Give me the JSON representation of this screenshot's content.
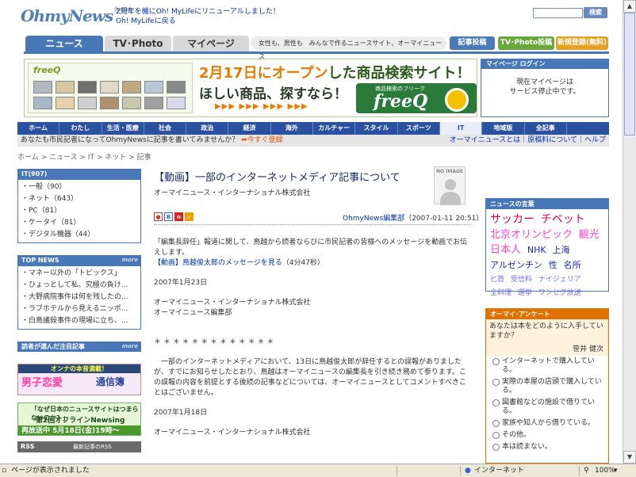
{
  "header": {
    "logo": "OhmyNews",
    "logo_small": "βversion",
    "announcement_1": "2周年を機にOh! MyLifeにリニューアルしました！",
    "announcement_2": "Oh! MyLifeに戻る",
    "search_placeholder": "",
    "search_label": "検索"
  },
  "main_tabs": [
    {
      "label": "ニュース"
    },
    {
      "label": "TV･Photo"
    },
    {
      "label": "マイページ"
    }
  ],
  "catchphrase_1": "女性も、男性も",
  "catchphrase_2": "みんなで作るニュースサイト、オーマイニュース",
  "header_buttons": {
    "post": "記事投稿",
    "tv_post": "TV･Photo投稿",
    "register": "新規登録(無料)"
  },
  "banner": {
    "small_logo": "freeQ",
    "headline_em": "2月17日にオープン",
    "headline_rest": "した商品検索サイト！",
    "subline": "ほしい商品、探すなら！",
    "arrows": "▶▶▶ ▶▶▶ ▶▶▶ ▶▶▶",
    "freeq_caption": "商品検索のフリーク",
    "freeq_logo": "freeQ"
  },
  "mypage_login": {
    "heading": "マイページ ログイン",
    "line1": "現在マイページは",
    "line2": "サービス停止中です。"
  },
  "categories": [
    {
      "label": "ホーム"
    },
    {
      "label": "わたし"
    },
    {
      "label": "生活・医療"
    },
    {
      "label": "社会"
    },
    {
      "label": "政治"
    },
    {
      "label": "経済"
    },
    {
      "label": "海外"
    },
    {
      "label": "カルチャー"
    },
    {
      "label": "スタイル"
    },
    {
      "label": "スポーツ"
    },
    {
      "label": "IT"
    },
    {
      "label": "地域版"
    },
    {
      "label": "全記事"
    }
  ],
  "subbar": {
    "prompt": "あなたも市民記者になってOhmyNewsに記事を書いてみませんか？",
    "cta": "今すぐ登録",
    "right": "オーマイニュースとは｜原稿料について｜ヘルプ"
  },
  "breadcrumb": "ホーム > ニュース > IT > ネット > 記事",
  "left": {
    "it_heading": "IT(907)",
    "it_items": [
      "・一般（90）",
      "・ネット（643）",
      "・PC（81）",
      "・ケータイ（81）",
      "・デジタル機器（44）"
    ],
    "topnews_heading": "TOP NEWS",
    "more": "more",
    "topnews_items": [
      "・マネー以外の「トピックス」",
      "・ひょっとして私、究極の負け...",
      "・大野病院事件は何を残したの...",
      "・ラブホテルから見えるニッポ...",
      "・白島議殺事件の現場に立ち、..."
    ],
    "reader_heading": "読者が選んだ注目記事",
    "ad1_top": "オンナの本音満載！",
    "ad1_left": "男子恋愛",
    "ad1_right": "通信簿",
    "ad2_line1": "「なぜ日本のニュースサイトはつまらないのか？」",
    "ad2_line2": "第2回オフラインNewsing",
    "ad2_bar": "再放送中 5月18日(金)19時〜",
    "rss_label": "RSS",
    "rss_text": "最新記事のRSS"
  },
  "article": {
    "title": "【動画】一部のインターネットメディア記事について",
    "byline": "オーマイニュース・インターナショナル株式会社",
    "noimage": "NO IMAGE",
    "author": "OhmyNews編集部",
    "date": "（2007-01-11 20:51）",
    "body_1": "「編集長辞任」報道に関して、鳥越から読者ならびに市民記者の皆様へのメッセージを動画でお伝えします。",
    "body_link": "【動画】鳥越俊太郎のメッセージを見る",
    "body_link_tail": "（4分47秒）",
    "date_1": "2007年1月23日",
    "org_1": "オーマイニュース・インターナショナル株式会社",
    "dept_1": "オーマイニュース編集部",
    "stars": "＊ ＊ ＊ ＊ ＊ ＊ ＊ ＊ ＊ ＊ ＊ ＊ ＊",
    "body_2": "　一部のインターネットメディアにおいて、13日に鳥越俊太郎が辞任するとの誤報がありましたが、すでにお知らせしたとおり、鳥越はオーマイニュースの編集長を引き続き務めて参ります。この誤報の内容を前提とする後続の記事などについては、オーマイニュースとしてコメントすべきことはございません。",
    "date_2": "2007年1月18日",
    "org_2": "オーマイニュース・インターナショナル株式会社"
  },
  "keywords": {
    "heading": "ニュースの言葉",
    "items": [
      {
        "text": "サッカー",
        "color": "#e0004a",
        "size": 14
      },
      {
        "text": "チベット",
        "color": "#e0004a",
        "size": 14
      },
      {
        "text": "北京オリンピック",
        "color": "#ff44cc",
        "size": 13
      },
      {
        "text": "観光",
        "color": "#ff44cc",
        "size": 13
      },
      {
        "text": "日本人",
        "color": "#ff44cc",
        "size": 13
      },
      {
        "text": "NHK",
        "color": "#1a2ab0",
        "size": 11
      },
      {
        "text": "上海",
        "color": "#1a2ab0",
        "size": 11
      },
      {
        "text": "アルゼンチン",
        "color": "#1a2ab0",
        "size": 11
      },
      {
        "text": "性",
        "color": "#1a2ab0",
        "size": 11
      },
      {
        "text": "名所",
        "color": "#1a2ab0",
        "size": 11
      },
      {
        "text": "匕首",
        "color": "#7070ff",
        "size": 9
      },
      {
        "text": "受信料",
        "color": "#7070ff",
        "size": 9
      },
      {
        "text": "ナイジェリア",
        "color": "#7070ff",
        "size": 9
      },
      {
        "text": "全料理",
        "color": "#7070ff",
        "size": 9
      },
      {
        "text": "選挙",
        "color": "#7070ff",
        "size": 9
      },
      {
        "text": "ワンセグ放送",
        "color": "#7070ff",
        "size": 9
      }
    ]
  },
  "poll": {
    "heading": "オーマイ･アンケート",
    "question": "あなたは本をどのように入手していますか？",
    "by": "笹井 健次",
    "options": [
      "インターネットで購入している。",
      "実際の本屋の店頭で購入している。",
      "図書館などの施設で借りている。",
      "家族や知人から借りている。",
      "その他。",
      "本は読まない。"
    ]
  },
  "statusbar": {
    "left": "ページが表示されました",
    "zone": "インターネット",
    "zoom": "100%"
  }
}
